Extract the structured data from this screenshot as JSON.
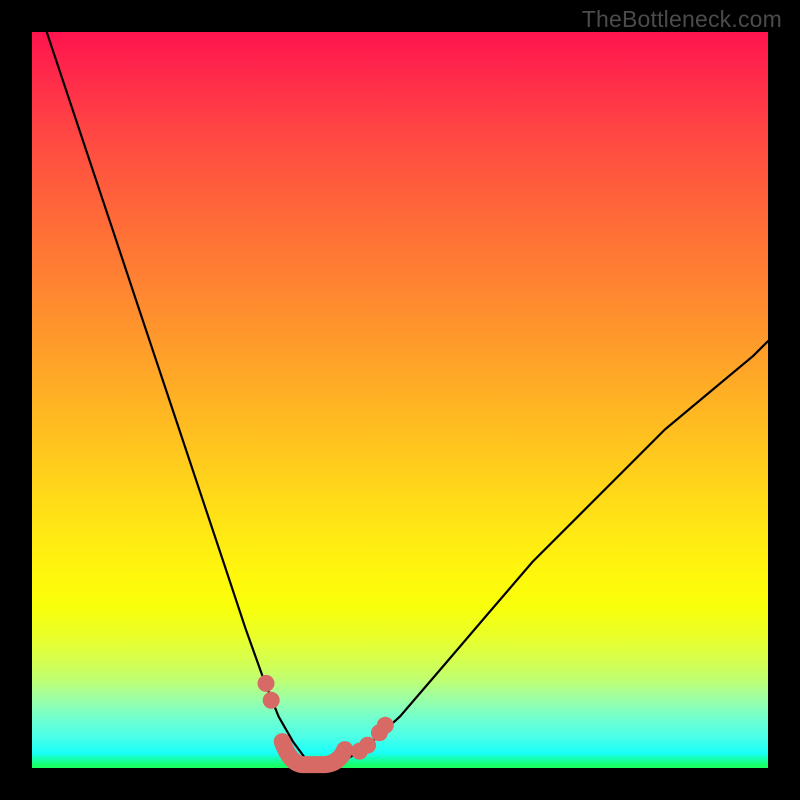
{
  "watermark": "TheBottleneck.com",
  "chart_data": {
    "type": "line",
    "title": "",
    "xlabel": "",
    "ylabel": "",
    "xlim": [
      0,
      100
    ],
    "ylim": [
      0,
      100
    ],
    "grid": false,
    "legend": false,
    "series": [
      {
        "name": "bottleneck-curve",
        "x": [
          2,
          5,
          8,
          11,
          14,
          17,
          20,
          23,
          26,
          29,
          31.5,
          33.5,
          35.5,
          37,
          38.5,
          40,
          42,
          45,
          50,
          56,
          62,
          68,
          74,
          80,
          86,
          92,
          98,
          100
        ],
        "y": [
          100,
          91,
          82,
          73,
          64,
          55,
          46,
          37,
          28,
          19,
          12,
          7,
          3.5,
          1.5,
          0.5,
          0.5,
          0.8,
          2.5,
          7,
          14,
          21,
          28,
          34,
          40,
          46,
          51,
          56,
          58
        ]
      }
    ],
    "markers": {
      "name": "highlight-dots",
      "color": "#d86a66",
      "points": [
        {
          "x": 31.8,
          "y": 11.5
        },
        {
          "x": 32.5,
          "y": 9.2
        },
        {
          "x": 44.5,
          "y": 2.3
        },
        {
          "x": 45.6,
          "y": 3.1
        },
        {
          "x": 47.2,
          "y": 4.8
        },
        {
          "x": 48.0,
          "y": 5.8
        }
      ],
      "bottom_segment": {
        "x_start": 34,
        "x_end": 42.5,
        "y": 0.6
      }
    },
    "gradient": {
      "top_color": "#ff144e",
      "mid_color": "#ffe814",
      "bottom_color": "#18ff5e"
    }
  }
}
